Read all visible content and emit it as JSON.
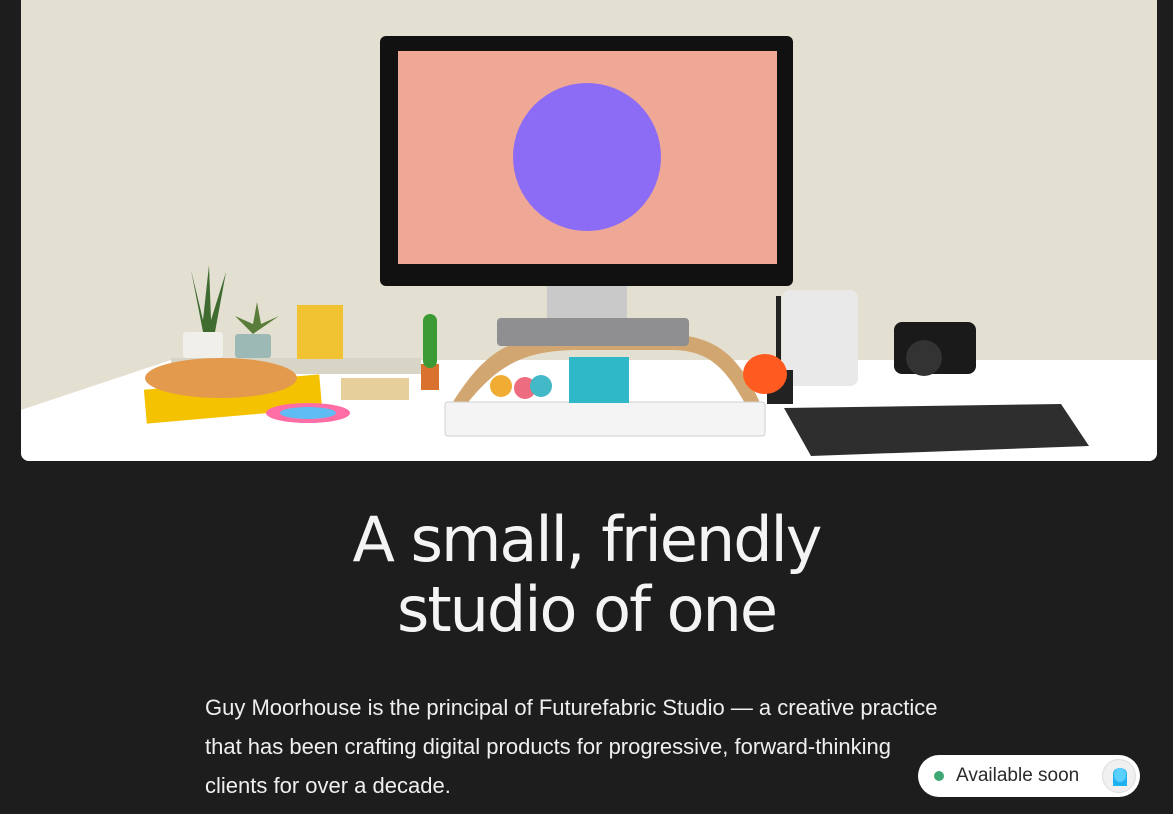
{
  "hero": {
    "monitor_screen_color": "#f0a896",
    "monitor_circle_color": "#8c6cf5",
    "backdrop_color": "#e4e0d1"
  },
  "headline": {
    "line1": "A small, friendly",
    "line2": "studio of one"
  },
  "intro": {
    "text": "Guy Moorhouse is the principal of Futurefabric Studio — a creative practice that has been crafting digital products for progressive, forward-thinking clients for over a decade."
  },
  "status": {
    "label": "Available soon",
    "dot_color": "#3fa774"
  }
}
